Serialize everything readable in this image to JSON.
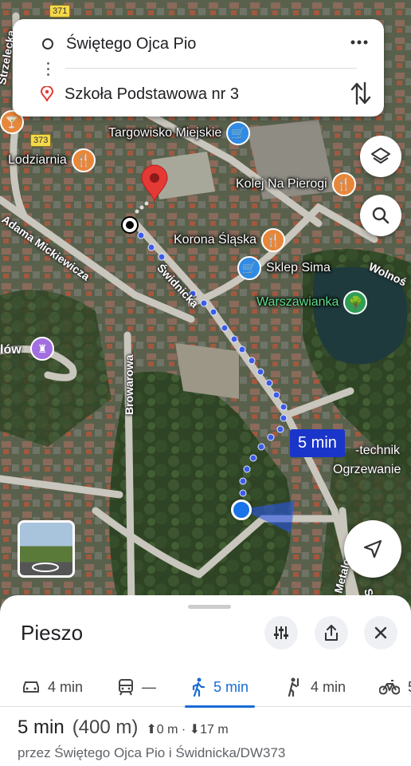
{
  "route": {
    "origin": "Świętego Ojca Pio",
    "destination": "Szkoła Podstawowa nr 3",
    "more_icon": "more-horiz-icon",
    "swap_icon": "swap-vertical-icon"
  },
  "map": {
    "road_shields": [
      "371",
      "373"
    ],
    "streets": {
      "strzelecka": "Strzelecka",
      "mickiewicza": "Adama Mickiewicza",
      "swidnicka": "Świdnicka",
      "browarowa": "Browarowa",
      "wolnosci": "Wolnoś",
      "metalowcow": "Metalowców",
      "lowcut": "lów",
      "s_cut": "S"
    },
    "pois": {
      "targowisko": "Targowisko Miejskie",
      "lodziarnia": "Lodziarnia",
      "kolej": "Kolej Na Pierogi",
      "korona": "Korona Śląska",
      "sima": "Sklep Sima",
      "warszawianka": "Warszawianka",
      "technik": "-technik",
      "ogrzewanie": "Ogrzewanie"
    },
    "eta_label": "5 min",
    "colors": {
      "route": "#1a35c9",
      "destination_pin": "#e53935",
      "location_dot": "#1a73e8"
    }
  },
  "sheet": {
    "title": "Pieszo",
    "modes": [
      {
        "icon": "car-icon",
        "label": "4 min"
      },
      {
        "icon": "transit-icon",
        "label": "—"
      },
      {
        "icon": "walk-icon",
        "label": "5 min",
        "active": true
      },
      {
        "icon": "ride-hailing-icon",
        "label": "4 min"
      },
      {
        "icon": "bike-icon",
        "label": "5"
      }
    ],
    "summary": {
      "time": "5 min",
      "distance": "(400 m)",
      "elevation": "⬆0 m · ⬇17 m"
    },
    "via": "przez Świętego Ojca Pio i Świdnicka/DW373"
  }
}
